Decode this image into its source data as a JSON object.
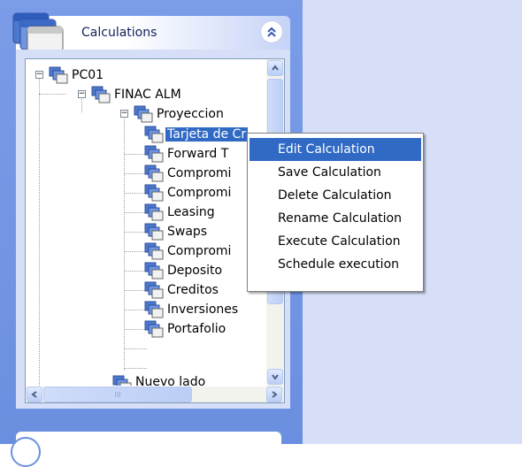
{
  "panel": {
    "title": "Calculations",
    "collapse_icon": "double-chevron-up-icon"
  },
  "tree": {
    "root": "PC01",
    "child": "FINAC ALM",
    "group": "Proyeccion",
    "items": [
      "Tarjeta de Cr",
      "Forward T",
      "Compromi",
      "Compromi",
      "Leasing",
      "Swaps",
      "Compromi",
      "Deposito",
      "Creditos",
      "Inversiones",
      "Portafolio"
    ],
    "selected_index": 0,
    "next_group_partial": "Nuevo lado"
  },
  "context_menu": {
    "items": [
      "Edit Calculation",
      "Save Calculation",
      "Delete Calculation",
      "Rename Calculation",
      "Execute Calculation",
      "Schedule execution"
    ],
    "active_index": 0
  },
  "scrollbar": {
    "h_thumb_label": "III"
  },
  "colors": {
    "selection": "#316ac5",
    "taskpane": "#6b8fe0",
    "tree_bg": "#ffffff"
  }
}
